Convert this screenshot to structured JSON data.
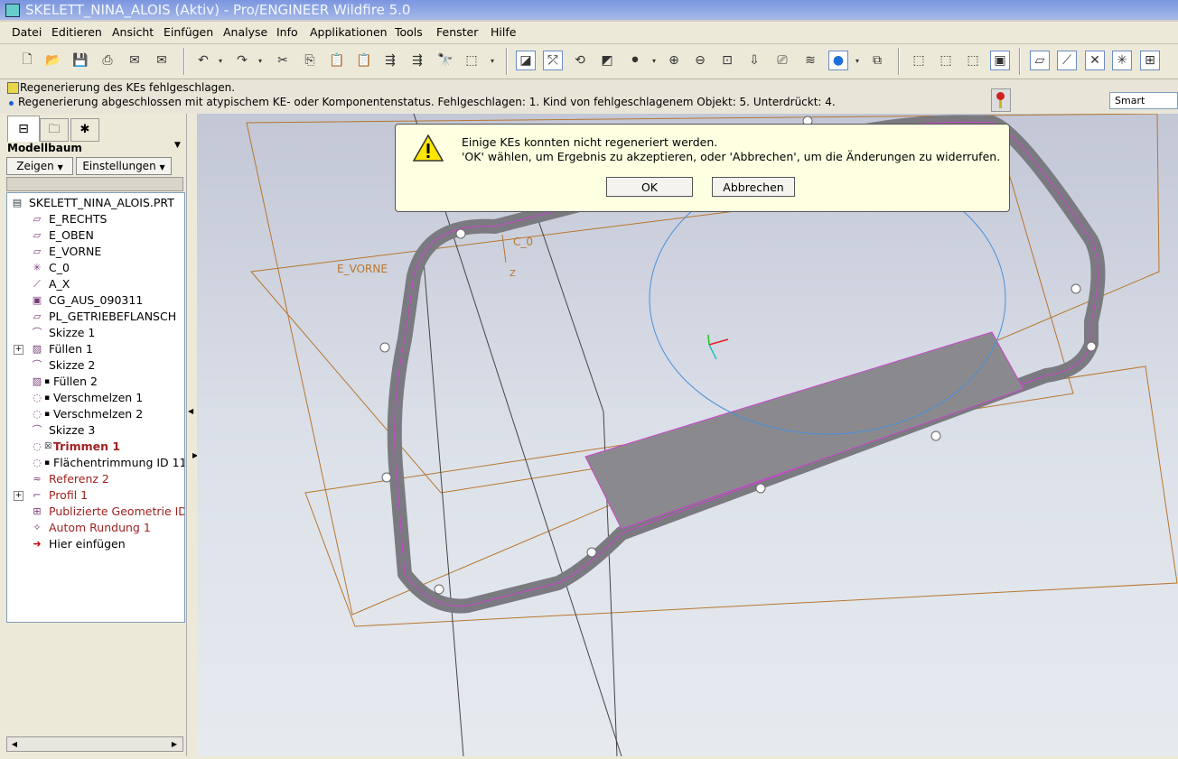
{
  "window": {
    "title": "SKELETT_NINA_ALOIS (Aktiv) - Pro/ENGINEER Wildfire 5.0"
  },
  "menu": [
    "Datei",
    "Editieren",
    "Ansicht",
    "Einfügen",
    "Analyse",
    "Info",
    "Applikationen",
    "Tools",
    "Fenster",
    "Hilfe"
  ],
  "messages": {
    "line1": "Regenerierung des KEs fehlgeschlagen.",
    "line2": "Regenerierung abgeschlossen mit atypischem KE- oder Komponentenstatus. Fehlgeschlagen: 1. Kind von fehlgeschlagenem Objekt: 5. Unterdrückt: 4."
  },
  "filter": {
    "value": "Smart"
  },
  "model_tree": {
    "title": "Modellbaum",
    "show_label": "Zeigen",
    "settings_label": "Einstellungen",
    "root": "SKELETT_NINA_ALOIS.PRT",
    "items": [
      {
        "label": "E_RECHTS",
        "icon": "datum-plane-icon"
      },
      {
        "label": "E_OBEN",
        "icon": "datum-plane-icon"
      },
      {
        "label": "E_VORNE",
        "icon": "datum-plane-icon"
      },
      {
        "label": "C_0",
        "icon": "coordinate-system-icon"
      },
      {
        "label": "A_X",
        "icon": "datum-axis-icon"
      },
      {
        "label": "CG_AUS_090311",
        "icon": "import-icon"
      },
      {
        "label": "PL_GETRIEBEFLANSCH",
        "icon": "datum-plane-icon"
      },
      {
        "label": "Skizze 1",
        "icon": "sketch-icon"
      },
      {
        "label": "Füllen 1",
        "icon": "fill-icon"
      },
      {
        "label": "Skizze 2",
        "icon": "sketch-icon"
      },
      {
        "label": "Füllen 2",
        "icon": "fill-icon"
      },
      {
        "label": "Verschmelzen 1",
        "icon": "merge-icon"
      },
      {
        "label": "Verschmelzen 2",
        "icon": "merge-icon"
      },
      {
        "label": "Skizze 3",
        "icon": "sketch-icon"
      },
      {
        "label": "Trimmen 1",
        "icon": "trim-icon"
      },
      {
        "label": "Flächentrimmung ID 11",
        "icon": "trim-icon"
      },
      {
        "label": "Referenz 2",
        "icon": "reference-icon"
      },
      {
        "label": "Profil 1",
        "icon": "profile-icon"
      },
      {
        "label": "Publizierte Geometrie ID",
        "icon": "publish-geometry-icon"
      },
      {
        "label": "Autom Rundung 1",
        "icon": "round-icon"
      },
      {
        "label": "Hier einfügen",
        "icon": "insert-here-icon"
      }
    ]
  },
  "viewport": {
    "labels": {
      "plane": "E_VORNE",
      "csys": "C_0",
      "z": "Z"
    }
  },
  "dialog": {
    "line1": "Einige KEs konnten nicht regeneriert werden.",
    "line2": "'OK' wählen, um Ergebnis zu akzeptieren, oder 'Abbrechen', um die Änderungen zu widerrufen.",
    "ok": "OK",
    "cancel": "Abbrechen"
  },
  "colors": {
    "title_bar": "#7a96df",
    "failed_feature": "#a02020",
    "curve": "#4a90d9",
    "datum": "#b8762e",
    "highlight": "#cc44cc"
  }
}
